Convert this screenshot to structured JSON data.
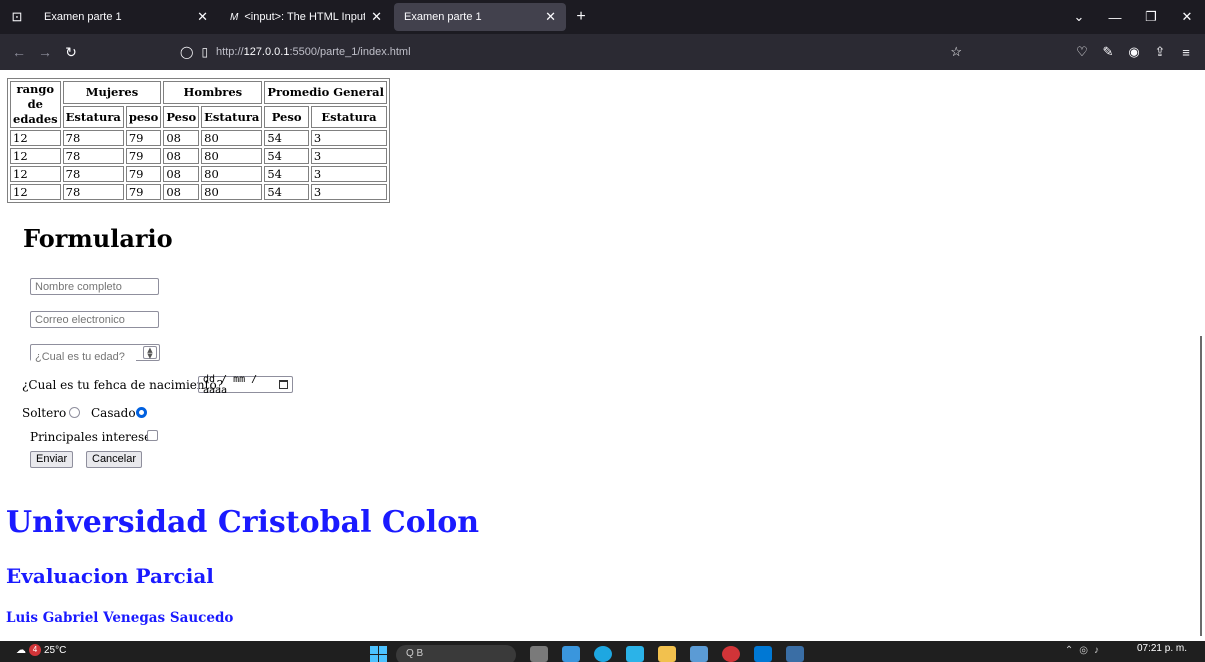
{
  "browser": {
    "tabs": [
      {
        "title": "Examen parte 1",
        "favicon": "",
        "active": false
      },
      {
        "title": "<input>: The HTML Input elem",
        "favicon": "M",
        "active": false
      },
      {
        "title": "Examen parte 1",
        "favicon": "",
        "active": true
      }
    ],
    "url_prefix": "http://",
    "url_host": "127.0.0.1",
    "url_rest": ":5500/parte_1/index.html"
  },
  "table": {
    "header_row1": [
      {
        "label": "rango de edades",
        "colspan": 1,
        "rowspan": 2
      },
      {
        "label": "Mujeres",
        "colspan": 2,
        "rowspan": 1
      },
      {
        "label": "Hombres",
        "colspan": 2,
        "rowspan": 1
      },
      {
        "label": "Promedio General",
        "colspan": 2,
        "rowspan": 1
      }
    ],
    "header_row2": [
      "Estatura",
      "peso",
      "Peso",
      "Estatura",
      "Peso",
      "Estatura"
    ],
    "rows": [
      [
        "12",
        "78",
        "79",
        "08",
        "80",
        "54",
        "3"
      ],
      [
        "12",
        "78",
        "79",
        "08",
        "80",
        "54",
        "3"
      ],
      [
        "12",
        "78",
        "79",
        "08",
        "80",
        "54",
        "3"
      ],
      [
        "12",
        "78",
        "79",
        "08",
        "80",
        "54",
        "3"
      ]
    ]
  },
  "form": {
    "title": "Formulario",
    "name_placeholder": "Nombre completo",
    "email_placeholder": "Correo electronico",
    "age_placeholder": "¿Cual es tu edad?",
    "birth_label": "¿Cual es tu fehca de nacimiento?",
    "date_placeholder": "dd / mm / aaaa",
    "single_label": "Soltero",
    "married_label": "Casado",
    "interests_label": "Principales intereses",
    "submit_label": "Enviar",
    "cancel_label": "Cancelar"
  },
  "footer": {
    "university": "Universidad Cristobal Colon",
    "evaluation": "Evaluacion Parcial",
    "author": "Luis Gabriel Venegas Saucedo"
  },
  "taskbar": {
    "weather": "25°C",
    "weather_badge": "4",
    "search_placeholder": "Q B",
    "clock": "07:21 p. m."
  }
}
